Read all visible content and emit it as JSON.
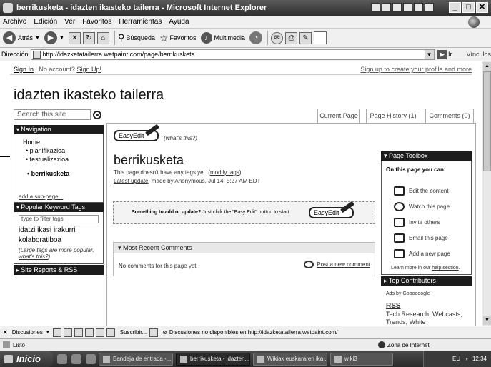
{
  "window": {
    "title": "berrikusketa - idazten ikasteko tailerra - Microsoft Internet Explorer",
    "controls": [
      "_",
      "□",
      "✕"
    ]
  },
  "menu": [
    "Archivo",
    "Edición",
    "Ver",
    "Favoritos",
    "Herramientas",
    "Ayuda"
  ],
  "toolbar": {
    "back": "Atrás",
    "search": "Búsqueda",
    "favorites": "Favoritos",
    "multimedia": "Multimedia"
  },
  "address": {
    "label": "Dirección",
    "url": "http://idazketatailerra.wetpaint.com/page/berrikusketa",
    "go": "Ir",
    "links": "Vínculos"
  },
  "page": {
    "sign_in": "Sign In",
    "no_account": "No account?",
    "sign_up": "Sign Up!",
    "signup_profile": "Sign up to create your profile and more",
    "site_title": "idazten ikasteko tailerra",
    "search_placeholder": "Search this site",
    "tabs": {
      "current": "Current Page",
      "history": "Page History (1)",
      "comments": "Comments (0)"
    },
    "navigation": {
      "title": "Navigation",
      "home": "Home",
      "items": [
        "planifikazioa",
        "testualizazioa"
      ],
      "current": "berrikusketa",
      "add_subpage": "add a sub-page..."
    },
    "tags": {
      "title": "Popular Keyword Tags",
      "filter_placeholder": "type to filter tags",
      "list": [
        "idatzi",
        "ikasi",
        "irakurri",
        "kolaboratiboa"
      ],
      "note_text": "(Large tags are more popular.",
      "note_link": "what's this?",
      "note_end": ")"
    },
    "site_reports": "Site Reports & RSS",
    "easyedit_label": "EasyEdit",
    "whats_this": "(what's this?)",
    "heading": "berrikusketa",
    "no_tags_text": "This page doesn't have any tags yet. (",
    "modify_tags": "modify tags",
    "no_tags_end": ")",
    "latest_update_label": "Latest update",
    "latest_update_text": ": made by Anonymous, Jul 14, 5:27 AM EDT",
    "addbox_bold": "Something to add or update?",
    "addbox_text": " Just click the \"Easy Edit\" button to start.",
    "comments": {
      "title": "Most Recent Comments",
      "empty": "No comments for this page yet.",
      "post": "Post a new comment"
    },
    "toolbox": {
      "title": "Page Toolbox",
      "subtitle": "On this page you can:",
      "items": [
        "Edit the content",
        "Watch this page",
        "Invite others",
        "Email this page",
        "Add a new page"
      ],
      "learn_text": "Learn more in our ",
      "learn_link": "help section",
      "learn_end": "."
    },
    "top_contributors": "Top Contributors",
    "ads_by": "Ads by Goooooogle",
    "rss_title": "RSS",
    "rss_text": "Tech Research, Webcasts, Trends, White"
  },
  "linksbar": {
    "discussions": "Discusiones",
    "subscribe": "Suscribir...",
    "message": "Discusiones no disponibles en http://idazketatailerra.wetpaint.com/"
  },
  "status": {
    "text": "Listo",
    "zone": "Zona de Internet"
  },
  "taskbar": {
    "start": "Inicio",
    "tasks": [
      "Bandeja de entrada -...",
      "berrikusketa - idazten...",
      "Wikiak euskararen ika...",
      "wiki3"
    ],
    "lang": "EU",
    "time": "12:34"
  }
}
